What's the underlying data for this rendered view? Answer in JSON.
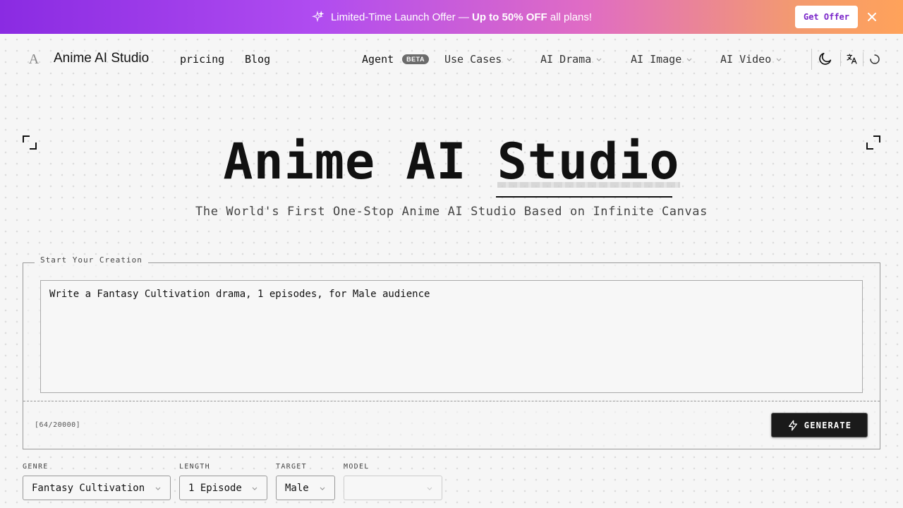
{
  "banner": {
    "message_prefix": "Limited-Time Launch Offer — ",
    "message_strong": "Up to 50% OFF",
    "message_suffix": " all plans!",
    "cta_label": "Get Offer",
    "close_icon": "close-icon",
    "sparkle_icon": "sparkle-icon"
  },
  "nav": {
    "brand": "Anime AI Studio",
    "logo_letter": "A",
    "links": [
      "pricing",
      "Blog"
    ],
    "agent_label": "Agent",
    "agent_badge": "BETA",
    "dropdowns": [
      "Use Cases",
      "AI Drama",
      "AI Image",
      "AI Video"
    ],
    "icons": [
      "moon-icon",
      "translate-icon",
      "loading-icon"
    ]
  },
  "hero": {
    "title_plain": "Anime AI ",
    "title_highlight": "Studio",
    "subtitle": "The World's First One-Stop Anime AI Studio Based on Infinite Canvas"
  },
  "creation": {
    "legend": "Start Your Creation",
    "prompt_value": "Write a Fantasy Cultivation drama, 1 episodes, for Male audience",
    "counter": "[64/20000]",
    "generate_label": "GENERATE",
    "generate_icon": "bolt-icon"
  },
  "options": {
    "genre": {
      "label": "GENRE",
      "value": "Fantasy Cultivation"
    },
    "length": {
      "label": "LENGTH",
      "value": "1 Episode"
    },
    "target": {
      "label": "TARGET",
      "value": "Male"
    },
    "model": {
      "label": "MODEL",
      "value": ""
    }
  },
  "colors": {
    "banner_start": "#8a2be2",
    "banner_end": "#ffa25a",
    "offer_text": "#7a25c9",
    "button_dark": "#1a1a1a"
  }
}
